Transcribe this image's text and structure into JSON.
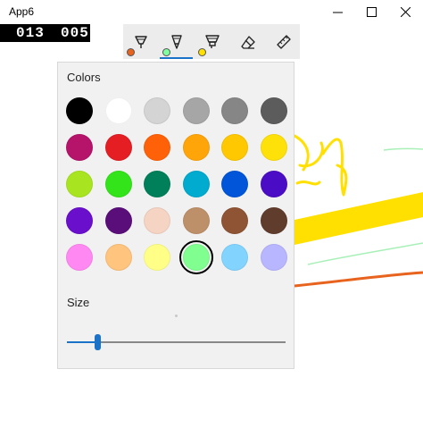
{
  "window": {
    "title": "App6",
    "minimize_icon": "minimize-icon",
    "maximize_icon": "maximize-icon",
    "close_icon": "close-icon"
  },
  "counter": {
    "first": "013",
    "second": "005"
  },
  "toolbar": {
    "tools": [
      {
        "name": "ballpoint-pen",
        "icon": "ballpoint-pen-icon",
        "dot_color": "#E8641E",
        "selected": false
      },
      {
        "name": "pencil",
        "icon": "pencil-icon",
        "dot_color": "#80FFA0",
        "selected": true
      },
      {
        "name": "highlighter",
        "icon": "highlighter-icon",
        "dot_color": "#FFE000",
        "selected": false
      },
      {
        "name": "eraser",
        "icon": "eraser-icon",
        "selected": false
      },
      {
        "name": "ruler",
        "icon": "ruler-icon",
        "selected": false
      }
    ]
  },
  "flyout": {
    "colors_label": "Colors",
    "size_label": "Size",
    "selected_color": "#80FF90",
    "size_value": 0.14,
    "swatches": [
      "#000000",
      "#FFFFFF",
      "#D4D4D4",
      "#A6A6A6",
      "#868686",
      "#5C5C5C",
      "#B5146A",
      "#E51E24",
      "#FF6108",
      "#FFA50A",
      "#FFC800",
      "#FFE10A",
      "#A8E520",
      "#33E41A",
      "#00805A",
      "#00ABD0",
      "#0055D9",
      "#4B0CC5",
      "#6A0FCC",
      "#5A0E7A",
      "#F6D4C4",
      "#BE9069",
      "#8E5434",
      "#603C2C",
      "#FF88F2",
      "#FFC47E",
      "#FFFF88",
      "#80FF90",
      "#82D4FF",
      "#B8B6FF"
    ]
  },
  "canvas": {
    "stroke_colors": [
      "#FFE000",
      "#FFE000",
      "#E8641E",
      "#A8F0B8"
    ]
  }
}
